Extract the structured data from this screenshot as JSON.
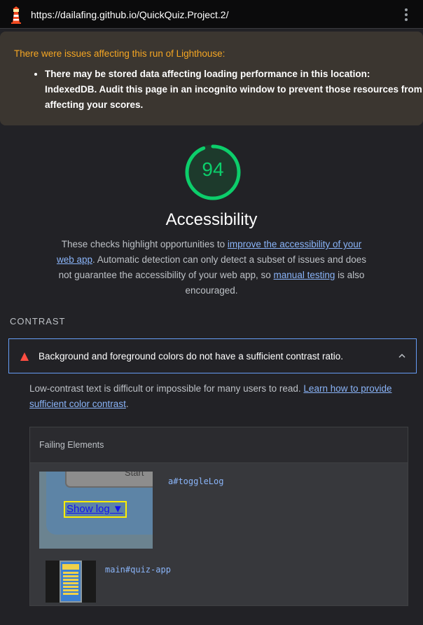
{
  "browser": {
    "url": "https://dailafing.github.io/QuickQuiz.Project.2/",
    "logo_icon": "lighthouse-icon",
    "menu_icon": "kebab-menu-icon"
  },
  "warning": {
    "title": "There were issues affecting this run of Lighthouse:",
    "items": [
      "There may be stored data affecting loading performance in this location: IndexedDB. Audit this page in an incognito window to prevent those resources from affecting your scores."
    ]
  },
  "category": {
    "score": "94",
    "score_fraction": 0.94,
    "title": "Accessibility",
    "description_1": "These checks highlight opportunities to ",
    "link_1": "improve the accessibility of your web app",
    "description_2": ". Automatic detection can only detect a subset of issues and does not guarantee the accessibility of your web app, so ",
    "link_2": "manual testing",
    "description_3": " is also encouraged."
  },
  "group": {
    "title": "CONTRAST"
  },
  "audit": {
    "title": "Background and foreground colors do not have a sufficient contrast ratio.",
    "description": "Low-contrast text is difficult or impossible for many users to read. ",
    "link": "Learn how to provide sufficient color contrast",
    "description_end": "."
  },
  "table": {
    "header": "Failing Elements",
    "rows": [
      {
        "selector": "a#toggleLog",
        "snapshot_text": "Show log ▼",
        "snapshot_partial_text": "Start"
      },
      {
        "selector": "main#quiz-app"
      }
    ]
  },
  "colors": {
    "pass": "#0cce6b",
    "fail": "#ff4e42",
    "link": "#8ab4f8",
    "warning": "#f5a623"
  }
}
